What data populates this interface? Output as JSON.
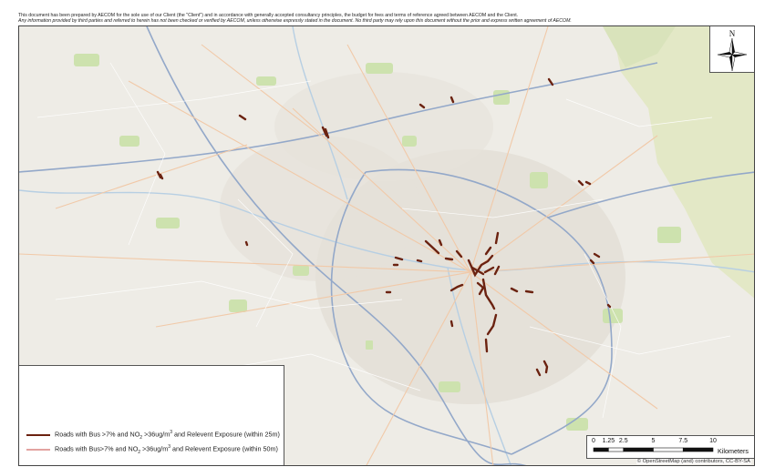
{
  "disclaimer": {
    "line1": "This document has been prepared by AECOM for the sole use of our Client (the \"Client\") and in accordance with generally accepted consultancy principles, the budget for fees and terms of reference agreed between AECOM and the Client.",
    "line2": "Any information provided by third parties and referred to herein has not been checked or verified by AECOM, unless otherwise expressly stated in the document. No third party may rely upon this document without the prior and express written agreement of AECOM."
  },
  "north_arrow": {
    "label": "N",
    "icon": "north-arrow-compass-icon"
  },
  "legend": {
    "items": [
      {
        "label_prefix": "Roads with Bus >7% and NO",
        "label_sub": "2",
        "label_mid": " >36ug/m",
        "label_sup": "3",
        "label_suffix": " and Relevent Exposure (within 25m)",
        "color": "#6b2210"
      },
      {
        "label_prefix": "Roads with Bus>7% and NO",
        "label_sub": "2",
        "label_mid": " >36ug/m",
        "label_sup": "3",
        "label_suffix": " and Relevent Exposure (within 50m)",
        "color": "#e3a3a0"
      }
    ]
  },
  "scale_bar": {
    "ticks": [
      "0",
      "1.25",
      "2.5",
      "5",
      "7.5",
      "10"
    ],
    "tick_values_km": [
      0,
      1.25,
      2.5,
      5,
      7.5,
      10
    ],
    "units": "Kilometers"
  },
  "attribution": "© OpenStreetMap (and) contributors, CC-BY-SA",
  "colors": {
    "road_25m": "#6b2210",
    "road_50m": "#e3a3a0",
    "basemap_bg": "#eeece6",
    "urban": "#e4e0d8",
    "green": "#cfe3b0",
    "upland": "#e4e8c8"
  }
}
